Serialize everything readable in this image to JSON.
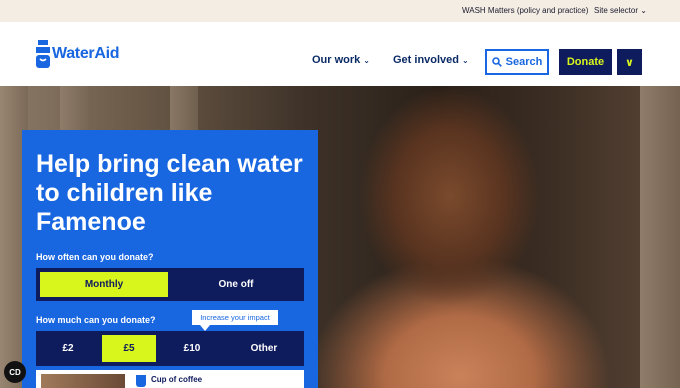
{
  "utility": {
    "wash_link": "WASH Matters (policy and practice)",
    "site_selector": "Site selector",
    "chevron": "⌄"
  },
  "header": {
    "logo_text": "WaterAid",
    "nav": [
      {
        "label": "Our work",
        "chevron": "⌄"
      },
      {
        "label": "Get involved",
        "chevron": "⌄"
      }
    ],
    "search_label": "Search",
    "donate_label": "Donate",
    "more_chevron": "∨"
  },
  "panel": {
    "title": "Help bring clean water to children like Famenoe",
    "frequency_question": "How often can you donate?",
    "frequency_options": [
      "Monthly",
      "One off"
    ],
    "frequency_selected": "Monthly",
    "amount_question": "How much can you donate?",
    "tooltip": "Increase your impact",
    "amount_options": [
      "£2",
      "£5",
      "£10",
      "Other"
    ],
    "amount_selected": "£5",
    "impact_text": "Cup of coffee"
  },
  "accessibility_button": "CD",
  "colors": {
    "brand_blue": "#1866e0",
    "navy": "#0e1b5c",
    "lime": "#d8f51c",
    "utility_bg": "#f4ede4"
  }
}
